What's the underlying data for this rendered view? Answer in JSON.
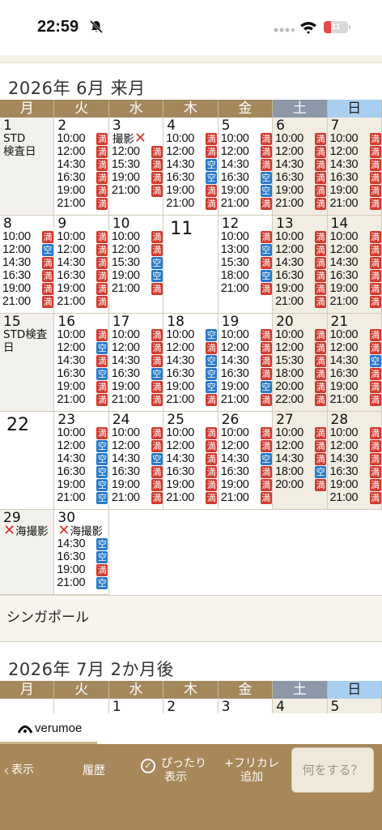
{
  "status_bar": {
    "time": "22:59",
    "battery": "11"
  },
  "weekdays": [
    "月",
    "火",
    "水",
    "木",
    "金",
    "土",
    "日"
  ],
  "june": {
    "title": "2026年 6月 来月",
    "weeks": [
      [
        {
          "day": "1",
          "note": "STD\n検査日"
        },
        {
          "day": "2",
          "slots": [
            [
              "10:00",
              "満"
            ],
            [
              "12:00",
              "満"
            ],
            [
              "14:30",
              "満"
            ],
            [
              "16:30",
              "満"
            ],
            [
              "19:00",
              "満"
            ],
            [
              "21:00",
              "満"
            ]
          ]
        },
        {
          "day": "3",
          "note": "撮影",
          "x": true,
          "slots_offset": 1,
          "slots": [
            [
              "12:00",
              "満"
            ],
            [
              "15:30",
              "満"
            ],
            [
              "19:00",
              "満"
            ],
            [
              "21:00",
              "満"
            ]
          ]
        },
        {
          "day": "4",
          "slots": [
            [
              "10:00",
              "満"
            ],
            [
              "12:00",
              "満"
            ],
            [
              "14:30",
              "空"
            ],
            [
              "16:30",
              "空"
            ],
            [
              "19:00",
              "満"
            ],
            [
              "21:00",
              "満"
            ]
          ]
        },
        {
          "day": "5",
          "slots": [
            [
              "10:00",
              "満"
            ],
            [
              "12:00",
              "満"
            ],
            [
              "14:30",
              "満"
            ],
            [
              "16:30",
              "空"
            ],
            [
              "19:00",
              "空"
            ],
            [
              "21:00",
              "満"
            ]
          ]
        },
        {
          "day": "6",
          "weekend": true,
          "slots": [
            [
              "10:00",
              "満"
            ],
            [
              "12:00",
              "満"
            ],
            [
              "14:30",
              "満"
            ],
            [
              "16:30",
              "満"
            ],
            [
              "19:00",
              "満"
            ],
            [
              "21:00",
              "満"
            ]
          ]
        },
        {
          "day": "7",
          "weekend": true,
          "slots": [
            [
              "10:00",
              "満"
            ],
            [
              "12:00",
              "満"
            ],
            [
              "14:30",
              "満"
            ],
            [
              "16:30",
              "満"
            ],
            [
              "19:00",
              "満"
            ],
            [
              "21:00",
              "満"
            ]
          ]
        }
      ],
      [
        {
          "day": "8",
          "slots": [
            [
              "10:00",
              "満"
            ],
            [
              "12:00",
              "空"
            ],
            [
              "14:30",
              "満"
            ],
            [
              "16:30",
              "満"
            ],
            [
              "19:00",
              "満"
            ],
            [
              "21:00",
              "満"
            ]
          ]
        },
        {
          "day": "9",
          "slots": [
            [
              "10:00",
              "満"
            ],
            [
              "12:00",
              "満"
            ],
            [
              "14:30",
              "満"
            ],
            [
              "16:30",
              "満"
            ],
            [
              "19:00",
              "満"
            ],
            [
              "21:00",
              "満"
            ]
          ]
        },
        {
          "day": "10",
          "slots": [
            [
              "10:00",
              "満"
            ],
            [
              "12:00",
              "満"
            ],
            [
              "15:30",
              "空"
            ],
            [
              "19:00",
              "空"
            ],
            [
              "21:00",
              "満"
            ]
          ]
        },
        {
          "day": "11",
          "big": true
        },
        {
          "day": "12",
          "slots": [
            [
              "10:00",
              "満"
            ],
            [
              "13:00",
              "空"
            ],
            [
              "15:30",
              "満"
            ],
            [
              "18:00",
              "空"
            ],
            [
              "21:00",
              "満"
            ]
          ]
        },
        {
          "day": "13",
          "weekend": true,
          "slots": [
            [
              "10:00",
              "満"
            ],
            [
              "12:00",
              "満"
            ],
            [
              "14:30",
              "満"
            ],
            [
              "16:30",
              "満"
            ],
            [
              "19:00",
              "満"
            ],
            [
              "21:00",
              "満"
            ]
          ]
        },
        {
          "day": "14",
          "weekend": true,
          "slots": [
            [
              "10:00",
              "満"
            ],
            [
              "12:00",
              "満"
            ],
            [
              "14:30",
              "満"
            ],
            [
              "16:30",
              "満"
            ],
            [
              "19:00",
              "満"
            ],
            [
              "21:00",
              "満"
            ]
          ]
        }
      ],
      [
        {
          "day": "15",
          "note": "STD検査\n日"
        },
        {
          "day": "16",
          "slots": [
            [
              "10:00",
              "満"
            ],
            [
              "12:00",
              "空"
            ],
            [
              "14:30",
              "満"
            ],
            [
              "16:30",
              "空"
            ],
            [
              "19:00",
              "満"
            ],
            [
              "21:00",
              "満"
            ]
          ]
        },
        {
          "day": "17",
          "slots": [
            [
              "10:00",
              "満"
            ],
            [
              "12:00",
              "満"
            ],
            [
              "14:30",
              "満"
            ],
            [
              "16:30",
              "空"
            ],
            [
              "19:00",
              "満"
            ],
            [
              "21:00",
              "満"
            ]
          ]
        },
        {
          "day": "18",
          "slots": [
            [
              "10:00",
              "空"
            ],
            [
              "12:00",
              "満"
            ],
            [
              "14:30",
              "空"
            ],
            [
              "16:30",
              "空"
            ],
            [
              "19:00",
              "空"
            ],
            [
              "21:00",
              "満"
            ]
          ]
        },
        {
          "day": "19",
          "slots": [
            [
              "10:00",
              "満"
            ],
            [
              "12:00",
              "満"
            ],
            [
              "14:30",
              "満"
            ],
            [
              "16:30",
              "満"
            ],
            [
              "19:00",
              "空"
            ],
            [
              "21:00",
              "満"
            ]
          ]
        },
        {
          "day": "20",
          "weekend": true,
          "slots": [
            [
              "10:00",
              "満"
            ],
            [
              "12:00",
              "満"
            ],
            [
              "15:30",
              "満"
            ],
            [
              "18:00",
              "満"
            ],
            [
              "20:00",
              "満"
            ],
            [
              "22:00",
              "満"
            ]
          ]
        },
        {
          "day": "21",
          "weekend": true,
          "slots": [
            [
              "10:00",
              "満"
            ],
            [
              "12:00",
              "満"
            ],
            [
              "14:30",
              "空"
            ],
            [
              "16:30",
              "満"
            ],
            [
              "19:00",
              "満"
            ],
            [
              "21:00",
              "満"
            ]
          ]
        }
      ],
      [
        {
          "day": "22",
          "big": true
        },
        {
          "day": "23",
          "slots": [
            [
              "10:00",
              "満"
            ],
            [
              "12:00",
              "空"
            ],
            [
              "14:30",
              "空"
            ],
            [
              "16:30",
              "空"
            ],
            [
              "19:00",
              "空"
            ],
            [
              "21:00",
              "空"
            ]
          ]
        },
        {
          "day": "24",
          "slots": [
            [
              "10:00",
              "満"
            ],
            [
              "12:00",
              "満"
            ],
            [
              "14:30",
              "空"
            ],
            [
              "16:30",
              "満"
            ],
            [
              "19:00",
              "満"
            ],
            [
              "21:00",
              "満"
            ]
          ]
        },
        {
          "day": "25",
          "slots": [
            [
              "10:00",
              "満"
            ],
            [
              "12:00",
              "満"
            ],
            [
              "14:30",
              "満"
            ],
            [
              "16:30",
              "満"
            ],
            [
              "19:00",
              "満"
            ],
            [
              "21:00",
              "満"
            ]
          ]
        },
        {
          "day": "26",
          "slots": [
            [
              "10:00",
              "満"
            ],
            [
              "12:00",
              "満"
            ],
            [
              "14:30",
              "空"
            ],
            [
              "16:30",
              "満"
            ],
            [
              "19:00",
              "満"
            ],
            [
              "21:00",
              "満"
            ]
          ]
        },
        {
          "day": "27",
          "weekend": true,
          "slots": [
            [
              "10:00",
              "満"
            ],
            [
              "12:00",
              "満"
            ],
            [
              "14:30",
              "満"
            ],
            [
              "18:00",
              "空"
            ],
            [
              "20:00",
              "満"
            ]
          ]
        },
        {
          "day": "28",
          "weekend": true,
          "slots": [
            [
              "10:00",
              "満"
            ],
            [
              "12:00",
              "満"
            ],
            [
              "14:30",
              "満"
            ],
            [
              "16:30",
              "満"
            ],
            [
              "19:00",
              "満"
            ],
            [
              "21:00",
              "満"
            ]
          ]
        }
      ],
      [
        {
          "day": "29",
          "note": "海撮影",
          "x": true,
          "gray": true
        },
        {
          "day": "30",
          "note": "海撮影",
          "x": true,
          "slots_offset": 1,
          "slots": [
            [
              "14:30",
              "空"
            ],
            [
              "16:30",
              "空"
            ],
            [
              "19:00",
              "満"
            ],
            [
              "21:00",
              "空"
            ]
          ]
        },
        {
          "empty": true
        },
        {
          "empty": true
        },
        {
          "empty": true
        },
        {
          "empty": true
        },
        {
          "empty": true
        }
      ]
    ]
  },
  "singapore_label": "シンガポール",
  "july": {
    "title": "2026年 7月 2か月後",
    "days": [
      "",
      "",
      "1",
      "2",
      "3",
      "4",
      "5"
    ]
  },
  "brand": "verumoe",
  "toolbar": {
    "back": "表示",
    "history": "履歴",
    "fit_line1": "ぴったり",
    "fit_line2": "表示",
    "free_line1": "+フリカレ",
    "free_line2": "追加",
    "what": "何をする？"
  }
}
